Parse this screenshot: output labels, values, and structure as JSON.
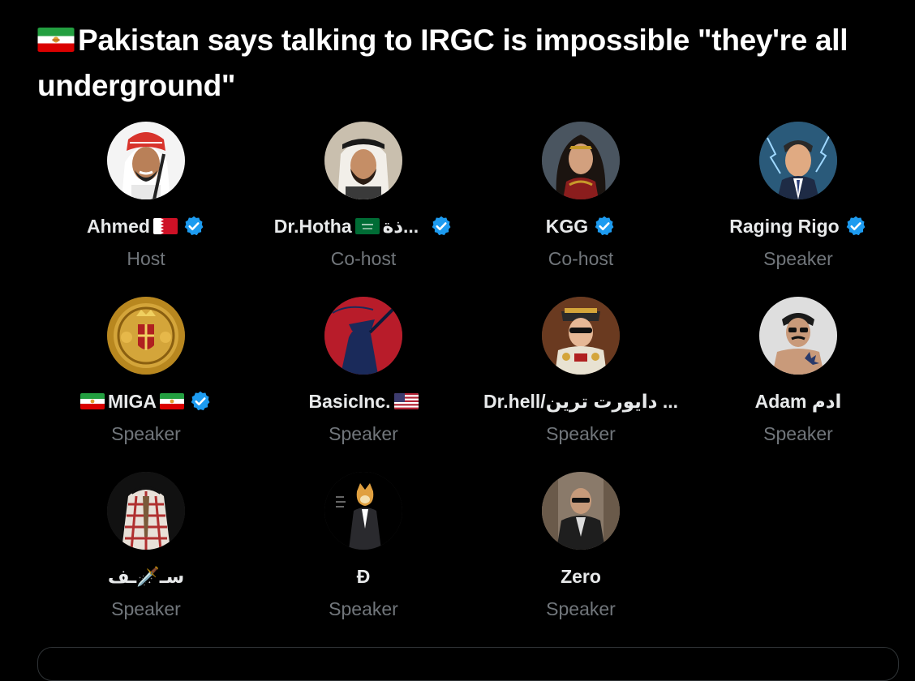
{
  "space": {
    "title": "Pakistan says talking to IRGC is impossible \"they're all underground\"",
    "title_flag_icon": "iran-lion-sun-flag-icon"
  },
  "participants": [
    {
      "name": "Ahmed",
      "role": "Host",
      "flag_icon": "bahrain-flag-icon",
      "verified": true
    },
    {
      "name": "Dr.Hotha",
      "name_extra": "ذة...",
      "role": "Co-host",
      "flag_icon": "saudi-flag-icon",
      "verified": true
    },
    {
      "name": "KGG",
      "role": "Co-host",
      "verified": true
    },
    {
      "name": "Raging Rigo",
      "role": "Speaker",
      "verified": true
    },
    {
      "name": "MIGA",
      "role": "Speaker",
      "flag_icon": "iran-lion-sun-flag-icon",
      "verified": true
    },
    {
      "name": "BasicInc.",
      "role": "Speaker",
      "flag_icon": "us-flag-icon",
      "verified": false
    },
    {
      "name": "Dr.hell/دایورت ترین ...",
      "role": "Speaker",
      "verified": false
    },
    {
      "name": "Adam ادم",
      "role": "Speaker",
      "verified": false
    },
    {
      "name": "سـ🗡️ـف",
      "role": "Speaker",
      "verified": false
    },
    {
      "name": "Đ",
      "role": "Speaker",
      "verified": false
    },
    {
      "name": "Zero",
      "role": "Speaker",
      "verified": false
    }
  ],
  "colors": {
    "background": "#000000",
    "name": "#e7e9ea",
    "role": "#71767b",
    "verified": "#1d9bf0"
  }
}
